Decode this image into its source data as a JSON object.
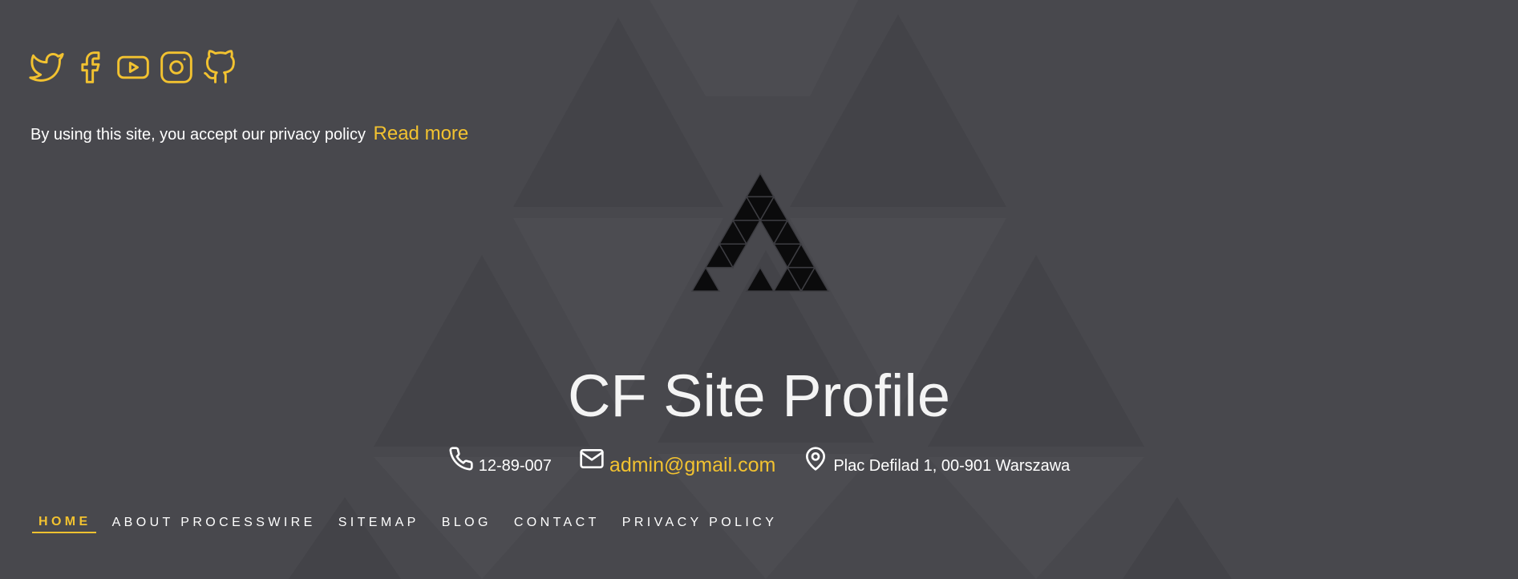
{
  "colors": {
    "background": "#48484d",
    "accent": "#f2c230",
    "text": "#ffffff"
  },
  "social": [
    {
      "icon": "twitter-icon"
    },
    {
      "icon": "facebook-icon"
    },
    {
      "icon": "youtube-icon"
    },
    {
      "icon": "instagram-icon"
    },
    {
      "icon": "github-icon"
    }
  ],
  "privacy": {
    "text": "By using this site, you accept our privacy policy",
    "link": "Read more"
  },
  "site": {
    "title": "CF Site Profile"
  },
  "contacts": {
    "phone": "12-89-007",
    "email": "admin@gmail.com",
    "address": "Plac Defilad 1, 00-901 Warszawa"
  },
  "nav": {
    "items": [
      {
        "label": "HOME",
        "active": true
      },
      {
        "label": "ABOUT PROCESSWIRE",
        "active": false
      },
      {
        "label": "SITEMAP",
        "active": false
      },
      {
        "label": "BLOG",
        "active": false
      },
      {
        "label": "CONTACT",
        "active": false
      },
      {
        "label": "PRIVACY POLICY",
        "active": false
      }
    ]
  }
}
